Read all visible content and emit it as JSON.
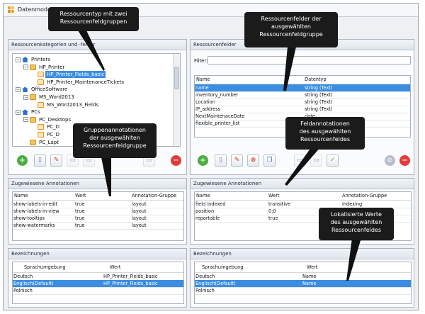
{
  "window": {
    "title": "Datenmodell"
  },
  "categories_panel": {
    "header": "Ressourcenkategorien und -felder",
    "tree": [
      {
        "label": "Printers",
        "icon": "house-icon",
        "expanded": true
      },
      {
        "label": "HP_Printer",
        "icon": "folder-icon",
        "expanded": true
      },
      {
        "label": "HP_Printer_Fields_basic",
        "icon": "field-icon",
        "selected": true
      },
      {
        "label": "HP_Printer_MaintenanceTickets",
        "icon": "field-icon"
      },
      {
        "label": "OfficeSoftware",
        "icon": "house-icon",
        "expanded": true
      },
      {
        "label": "MS_Word2013",
        "icon": "folder-icon",
        "expanded": true
      },
      {
        "label": "MS_Word2013_Fields",
        "icon": "field-icon"
      },
      {
        "label": "PCs",
        "icon": "house-icon",
        "expanded": true
      },
      {
        "label": "PC_Desktops",
        "icon": "folder-icon",
        "expanded": true
      },
      {
        "label": "PC_D",
        "icon": "field-icon"
      },
      {
        "label": "PC_D",
        "icon": "field-icon"
      },
      {
        "label": "PC_Lapt",
        "icon": "folder-icon"
      }
    ]
  },
  "fields_panel": {
    "header": "Ressourcenfelder",
    "filter_label": "Filter:",
    "filter_value": "",
    "columns": [
      "Name",
      "Datentyp"
    ],
    "rows": [
      {
        "name": "name",
        "type": "string (Text)",
        "selected": true
      },
      {
        "name": "inventory_number",
        "type": "string (Text)"
      },
      {
        "name": "Location",
        "type": "string (Text)"
      },
      {
        "name": "IP_address",
        "type": "string (Text)"
      },
      {
        "name": "NextMaintenaceDate",
        "type": "date"
      },
      {
        "name": "flexible_printer_list",
        "type": "string (Text)"
      }
    ]
  },
  "group_annotations_panel": {
    "header": "Zugewiesene Annotationen",
    "columns": [
      "Name",
      "Wert",
      "Annotation-Gruppe"
    ],
    "rows": [
      {
        "name": "show-labels-in-edit",
        "value": "true",
        "group": "layout"
      },
      {
        "name": "show-labels-in-view",
        "value": "true",
        "group": "layout"
      },
      {
        "name": "show-tooltips",
        "value": "true",
        "group": "layout"
      },
      {
        "name": "show-watermarks",
        "value": "true",
        "group": "layout"
      }
    ]
  },
  "field_annotations_panel": {
    "header": "Zugewiesene Annotationen",
    "columns": [
      "Name",
      "Wert",
      "Annotation-Gruppe"
    ],
    "rows": [
      {
        "name": "field indexed",
        "value": "transitive",
        "group": "indexing"
      },
      {
        "name": "position",
        "value": "0;0",
        "group": ""
      },
      {
        "name": "reportable",
        "value": "true",
        "group": ""
      }
    ]
  },
  "group_labels_panel": {
    "header": "Bezeichnungen",
    "columns": [
      "Sprachumgebung",
      "Wert"
    ],
    "rows": [
      {
        "locale": "Deutsch",
        "value": "HP_Printer_Fields_basic"
      },
      {
        "locale": "Englisch(Default)",
        "value": "HP_Printer_Fields_basic",
        "selected": true
      },
      {
        "locale": "Polnisch",
        "value": ""
      }
    ]
  },
  "field_labels_panel": {
    "header": "Bezeichnungen",
    "columns": [
      "Sprachumgebung",
      "Wert"
    ],
    "rows": [
      {
        "locale": "Deutsch",
        "value": "Name"
      },
      {
        "locale": "Englisch(Default)",
        "value": "Name",
        "selected": true
      },
      {
        "locale": "Polnisch",
        "value": ""
      }
    ]
  },
  "callouts": [
    {
      "lines": [
        "Ressourcentyp mit zwei",
        "Ressourcenfeldgruppen"
      ]
    },
    {
      "lines": [
        "Ressourcenfelder der",
        "ausgewählten",
        "Ressourcenfeldgruppe"
      ]
    },
    {
      "lines": [
        "Gruppenannotationen",
        "der ausgewählten",
        "Ressourcenfeldgruppe"
      ]
    },
    {
      "lines": [
        "Feldannotationen",
        "des ausgewählten",
        "Ressourcenfeldes"
      ]
    },
    {
      "lines": [
        "Lokalisierte Werte",
        "des ausgewählten",
        "Ressourcenfeldes"
      ]
    }
  ],
  "colors": {
    "selection": "#3b8de0",
    "callout_bg": "#1b1b1b",
    "add": "#4cae42",
    "delete": "#e23b3b"
  }
}
